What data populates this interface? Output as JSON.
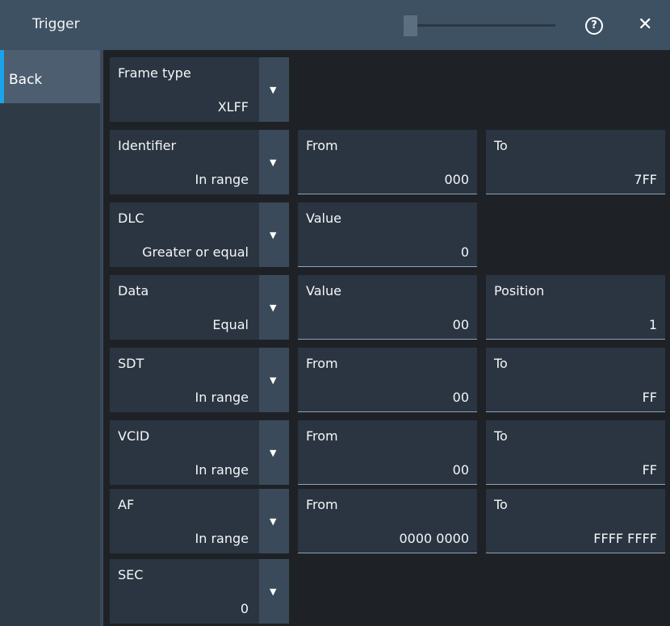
{
  "window": {
    "title": "Trigger",
    "help_glyph": "?",
    "close_glyph": "✕"
  },
  "sidebar": {
    "back_label": "Back",
    "accent_color": "#1aa3e8"
  },
  "rows": {
    "frame_type": {
      "label": "Frame type",
      "value": "XLFF"
    },
    "identifier": {
      "label": "Identifier",
      "value": "In range",
      "f1_label": "From",
      "f1_value": "000",
      "f2_label": "To",
      "f2_value": "7FF"
    },
    "dlc": {
      "label": "DLC",
      "value": "Greater or equal",
      "f1_label": "Value",
      "f1_value": "0"
    },
    "data": {
      "label": "Data",
      "value": "Equal",
      "f1_label": "Value",
      "f1_value": "00",
      "f2_label": "Position",
      "f2_value": "1"
    },
    "sdt": {
      "label": "SDT",
      "value": "In range",
      "f1_label": "From",
      "f1_value": "00",
      "f2_label": "To",
      "f2_value": "FF"
    },
    "vcid": {
      "label": "VCID",
      "value": "In range",
      "f1_label": "From",
      "f1_value": "00",
      "f2_label": "To",
      "f2_value": "FF"
    },
    "af": {
      "label": "AF",
      "value": "In range",
      "f1_label": "From",
      "f1_value": "0000 0000",
      "f2_label": "To",
      "f2_value": "FFFF FFFF"
    },
    "sec": {
      "label": "SEC",
      "value": "0"
    }
  },
  "dropdown_glyph": "▼"
}
